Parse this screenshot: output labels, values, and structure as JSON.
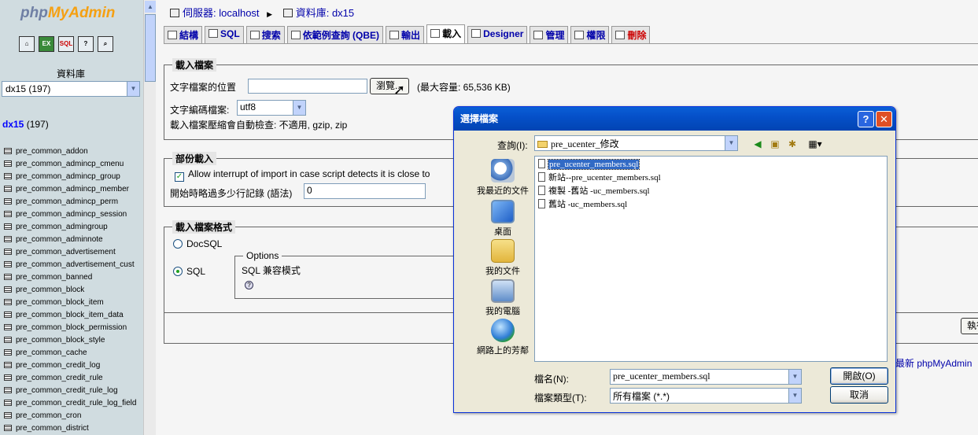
{
  "left_frame": {
    "logo_php": "php",
    "logo_myadmin": "MyAdmin",
    "toolbar_icons": [
      "home-icon",
      "exit-icon",
      "sql-icon",
      "help-icon",
      "docs-icon"
    ],
    "database_label": "資料庫",
    "database_selected": "dx15 (197)",
    "current_db": "dx15",
    "current_db_count": "(197)",
    "tables": [
      "pre_common_addon",
      "pre_common_admincp_cmenu",
      "pre_common_admincp_group",
      "pre_common_admincp_member",
      "pre_common_admincp_perm",
      "pre_common_admincp_session",
      "pre_common_admingroup",
      "pre_common_adminnote",
      "pre_common_advertisement",
      "pre_common_advertisement_cust",
      "pre_common_banned",
      "pre_common_block",
      "pre_common_block_item",
      "pre_common_block_item_data",
      "pre_common_block_permission",
      "pre_common_block_style",
      "pre_common_cache",
      "pre_common_credit_log",
      "pre_common_credit_rule",
      "pre_common_credit_rule_log",
      "pre_common_credit_rule_log_field",
      "pre_common_cron",
      "pre_common_district"
    ]
  },
  "breadcrumb": {
    "server_label": "伺服器: localhost",
    "db_label": "資料庫: dx15"
  },
  "tabs": [
    {
      "label": "結構",
      "icon": "structure-icon"
    },
    {
      "label": "SQL",
      "icon": "sql-icon"
    },
    {
      "label": "搜索",
      "icon": "search-icon"
    },
    {
      "label": "依範例查詢 (QBE)",
      "icon": "query-icon"
    },
    {
      "label": "輸出",
      "icon": "export-icon"
    },
    {
      "label": "載入",
      "icon": "import-icon",
      "active": true
    },
    {
      "label": "Designer",
      "icon": "designer-icon"
    },
    {
      "label": "管理",
      "icon": "operations-icon"
    },
    {
      "label": "權限",
      "icon": "privileges-icon"
    },
    {
      "label": "刪除",
      "icon": "drop-icon"
    }
  ],
  "import_file": {
    "legend": "載入檔案",
    "file_location_label": "文字檔案的位置",
    "browse_button": "瀏覽...",
    "max_size": "(最大容量: 65,536 KB)",
    "charset_label": "文字編碼檔案:",
    "charset_value": "utf8",
    "compression_note": "載入檔案壓縮會自動檢查: 不適用, gzip, zip"
  },
  "partial_import": {
    "legend": "部份載入",
    "allow_interrupt_label": "Allow interrupt of import in case script detects it is close to",
    "skip_label": "開始時略過多少行記錄 (語法)",
    "skip_value": "0"
  },
  "import_format": {
    "legend": "載入檔案格式",
    "options": [
      "DocSQL",
      "SQL"
    ],
    "selected": "SQL",
    "options_legend": "Options",
    "sql_compat_label": "SQL 兼容模式",
    "help_icon": "?"
  },
  "go_button": "執行",
  "footer_link": "最新 phpMyAdmin",
  "dialog": {
    "title": "選擇檔案",
    "look_in_label": "查詢(I):",
    "look_in_value": "pre_ucenter_修改",
    "places": [
      "我最近的文件",
      "桌面",
      "我的文件",
      "我的電腦",
      "網路上的芳鄰"
    ],
    "files": [
      "pre_ucenter_members.sql",
      "新站--pre_ucenter_members.sql",
      "複製 -舊站 -uc_members.sql",
      "舊站 -uc_members.sql"
    ],
    "selected_file": "pre_ucenter_members.sql",
    "filename_label": "檔名(N):",
    "filename_value": "pre_ucenter_members.sql",
    "filetype_label": "檔案類型(T):",
    "filetype_value": "所有檔案 (*.*)",
    "open_button": "開啟(O)",
    "cancel_button": "取消",
    "help_button": "?",
    "close_button": "✕"
  },
  "colors": {
    "titlebar": "#0550c9",
    "selection": "#316ac5",
    "link": "#0000aa",
    "frame_bg": "#d0dce0"
  }
}
